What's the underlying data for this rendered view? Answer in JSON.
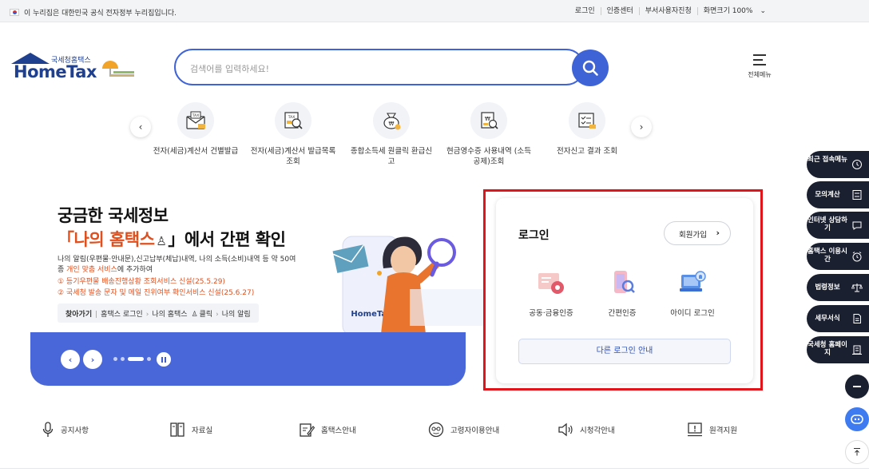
{
  "topbar": {
    "gov_notice": "이 누리집은 대한민국 공식 전자정부 누리집입니다.",
    "links": [
      "로그인",
      "인증센터",
      "부서사용자진청",
      "화면크기 100%"
    ]
  },
  "header": {
    "logo_sub": "국세청홈택스",
    "logo_main": "HomeTax",
    "search_placeholder": "검색어를 입력하세요!",
    "all_menu_label": "전체메뉴"
  },
  "quick_menu": [
    {
      "label": "전자(세금)계산서 건별발급",
      "icon": "tax-invoice-icon"
    },
    {
      "label": "전자(세금)계산서 발급목록 조회",
      "icon": "tax-list-search-icon"
    },
    {
      "label": "종합소득세 원클릭 환급신고",
      "icon": "refund-bag-icon"
    },
    {
      "label": "현금영수증 사용내역 (소득공제)조회",
      "icon": "receipt-search-icon"
    },
    {
      "label": "전자신고 결과 조회",
      "icon": "checklist-icon"
    }
  ],
  "banner": {
    "title_line1": "궁금한 국세정보",
    "title_line2_highlight": "「나의 홈택스",
    "title_line2_rest": "」에서 간편 확인",
    "desc_part1": "나의 알림(우편물·안내문),신고납부(체납)내역, 나의 소득(소비)내역 등 약 50여종 ",
    "desc_highlight": "개인 맞춤 서비스",
    "desc_part2": "에 추가하여",
    "notes": [
      "① 등기우편물 배송진행상황 조회서비스 신설(25.5.29)",
      "② 국세청 발송 문자 및 메일 진위여부 확인서비스 신설(25.6.27)"
    ],
    "path_label": "찾아가기",
    "path_steps": [
      "홈택스 로그인",
      "나의 홈택스",
      "클릭",
      "나의 알림"
    ],
    "phone_brand": "HomeTax"
  },
  "login": {
    "title": "로그인",
    "join_label": "회원가입",
    "options": [
      {
        "label": "공동·금융인증",
        "icon": "certificate-icon"
      },
      {
        "label": "간편인증",
        "icon": "simple-auth-icon"
      },
      {
        "label": "아이디 로그인",
        "icon": "id-login-icon"
      }
    ],
    "other_label": "다른 로그인 안내"
  },
  "side_menu": [
    {
      "label": "최근 접속메뉴",
      "icon": "clock-icon"
    },
    {
      "label": "모의계산",
      "icon": "calculator-icon"
    },
    {
      "label": "인터넷 상담하기",
      "icon": "chat-icon"
    },
    {
      "label": "홈택스 이용시간",
      "icon": "alarm-icon"
    },
    {
      "label": "법령정보",
      "icon": "scale-icon"
    },
    {
      "label": "세무서식",
      "icon": "document-icon"
    },
    {
      "label": "국세청 홈페이지",
      "icon": "building-icon"
    }
  ],
  "bottom_menu": [
    {
      "label": "공지사항",
      "icon": "microphone-icon"
    },
    {
      "label": "자료실",
      "icon": "binder-icon"
    },
    {
      "label": "홈택스안내",
      "icon": "guide-icon"
    },
    {
      "label": "고령자이용안내",
      "icon": "senior-icon"
    },
    {
      "label": "시청각안내",
      "icon": "speaker-icon"
    },
    {
      "label": "원격지원",
      "icon": "remote-support-icon"
    }
  ],
  "colors": {
    "brand": "#1f3f8f",
    "accent": "#3e63d6",
    "highlight": "#e0501f",
    "login_frame": "#e0151b",
    "dark_side": "#1b2030"
  }
}
